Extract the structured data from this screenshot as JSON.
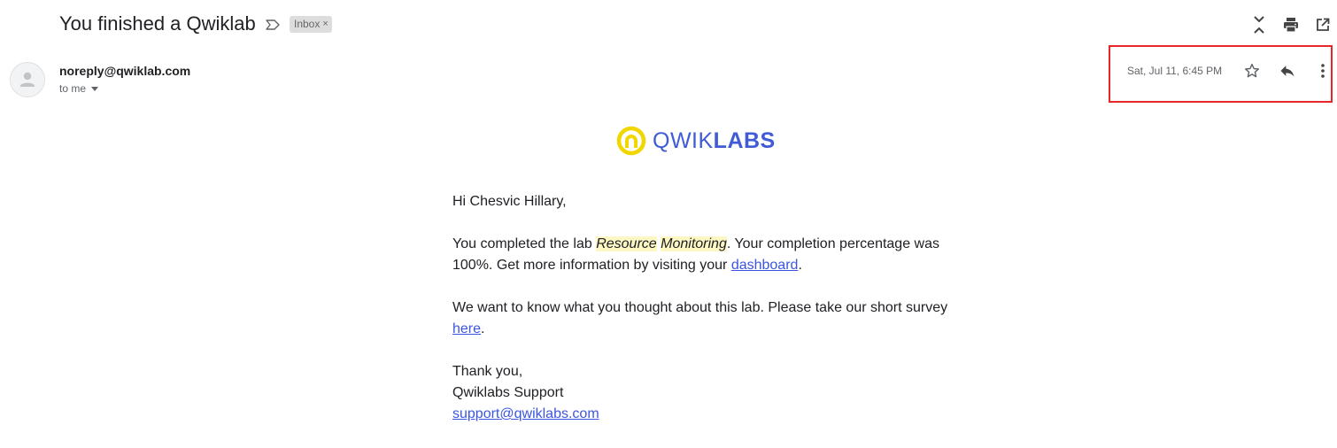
{
  "email": {
    "subject": "You finished a Qwiklab",
    "label": "Inbox",
    "label_close": "×",
    "sender": "noreply@qwiklab.com",
    "recipient": "to me",
    "date": "Sat, Jul 11, 6:45 PM"
  },
  "toolbar": {
    "icons": [
      "expand-collapse-icon",
      "print-icon",
      "open-in-new-window-icon"
    ]
  },
  "actions": {
    "icons": [
      "star-icon",
      "reply-icon",
      "more-vert-icon"
    ]
  },
  "highlight_color": "#e8262a",
  "brand": {
    "logo_thin": "QWIK",
    "logo_bold": "LABS",
    "logo_color": "#3f5bd6",
    "logo_ring_color": "#f2d600"
  },
  "body": {
    "greeting": "Hi Chesvic Hillary,",
    "p1_before": "You completed the lab ",
    "lab_word1": "Resource",
    "lab_word2": "Monitoring",
    "p1_after": ". Your completion percentage was 100%. Get more information by visiting your ",
    "dashboard_link": "dashboard",
    "p1_end": ".",
    "p2_before": "We want to know what you thought about this lab. Please take our short survey ",
    "survey_link": "here",
    "p2_end": ".",
    "closing": "Thank you,",
    "signature": "Qwiklabs Support",
    "support_email": "support@qwiklabs.com"
  }
}
